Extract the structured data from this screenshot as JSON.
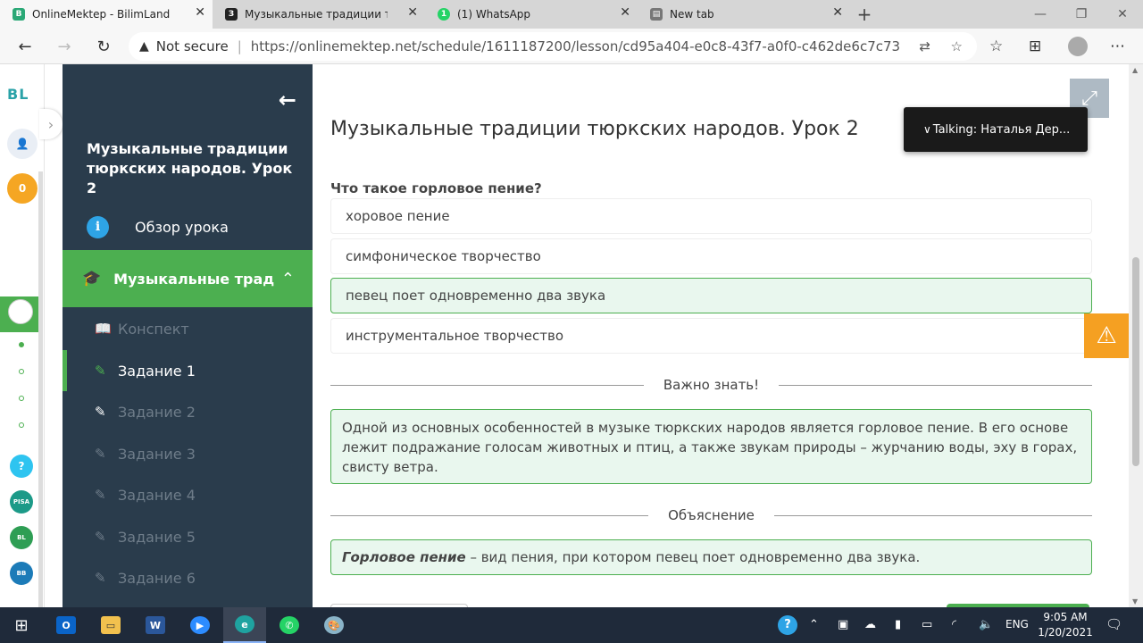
{
  "browser": {
    "tabs": [
      {
        "title": "OnlineMektep - BilimLand",
        "fav_color": "#2aa876",
        "fav_glyph": "B"
      },
      {
        "title": "Музыкальные традиции тюркск",
        "fav_color": "#222222",
        "fav_glyph": "З"
      },
      {
        "title": "(1) WhatsApp",
        "fav_color": "#25d366",
        "fav_glyph": "1"
      },
      {
        "title": "New tab",
        "fav_color": "#555555",
        "fav_glyph": "▤"
      }
    ],
    "not_secure": "Not secure",
    "url_host": "https://onlinemektep.net",
    "url_path": "/schedule/1611187200/lesson/cd95a404-e0c8-43f7-a0f0-c462de6c7c73"
  },
  "rail": {
    "logo": "BL",
    "points": "0"
  },
  "sidebar": {
    "title": "Музыкальные традиции тюркских народов. Урок 2",
    "overview": "Обзор урока",
    "current_lesson": "Музыкальные традиции тюркски...",
    "items": [
      {
        "label": "Конспект"
      },
      {
        "label": "Задание 1"
      },
      {
        "label": "Задание 2"
      },
      {
        "label": "Задание 3"
      },
      {
        "label": "Задание 4"
      },
      {
        "label": "Задание 5"
      },
      {
        "label": "Задание 6"
      }
    ]
  },
  "main": {
    "title": "Музыкальные традиции тюркских народов. Урок 2",
    "talking": "Talking: Наталья Дер...",
    "question": "Что такое горловое пение?",
    "options": [
      {
        "text": "хоровое пение",
        "correct": false
      },
      {
        "text": "симфоническое творчество",
        "correct": false
      },
      {
        "text": "певец поет одновременно два звука",
        "correct": true
      },
      {
        "text": "инструментальное творчество",
        "correct": false
      }
    ],
    "important_heading": "Важно знать!",
    "important_text": "Одной из основных особенностей в музыке тюркских народов является горловое пение. В его основе лежит подражание голосам животных и птиц, а также звукам природы – журчанию воды, эху в горах, свисту ветра.",
    "explanation_heading": "Объяснение",
    "explanation_term": "Горловое пение",
    "explanation_rest": " – вид пения, при котором певец поет одновременно два звука."
  },
  "taskbar": {
    "lang": "ENG",
    "time": "9:05 AM",
    "date": "1/20/2021"
  },
  "colors": {
    "accent": "#4caf50",
    "sidebar": "#2a3c4c",
    "alert": "#f5a022"
  }
}
